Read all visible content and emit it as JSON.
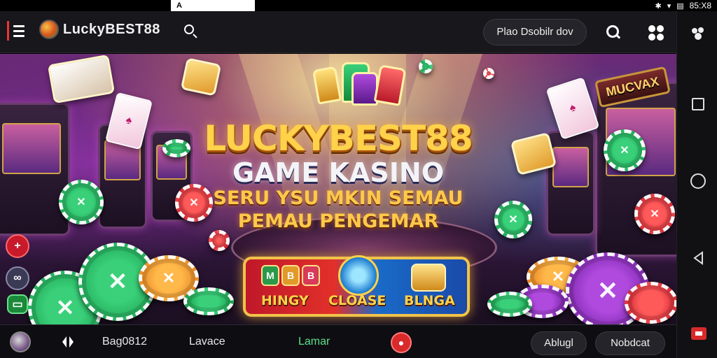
{
  "status_bar": {
    "app_label": "A",
    "time": "85:X8"
  },
  "header": {
    "brand": "LuckyBEST88",
    "promo_button": "Plao Dsobilr dov"
  },
  "hero": {
    "title": "LUCKYBEST88",
    "subtitle": "GAME KASINO",
    "tagline_line1": "SERU YSU MKIN SEMAU",
    "tagline_line2": "PEMAU PENGEMAR",
    "slot_sign": "MUCVAX",
    "panel": {
      "left_label": "HINGY",
      "center_label": "CLOASE",
      "right_label": "BLNGA",
      "badges": [
        "M",
        "B",
        "B"
      ]
    },
    "colors": {
      "gold": "#ffd24a",
      "chip_green": "#3ad07a",
      "chip_red": "#ff5a5a",
      "chip_purple": "#b04adf"
    }
  },
  "bottom_bar": {
    "item1": "Bag0812",
    "item2": "Lavace",
    "item3": "Lamar",
    "button_left": "Ablugl",
    "button_right": "Nobdcat"
  }
}
